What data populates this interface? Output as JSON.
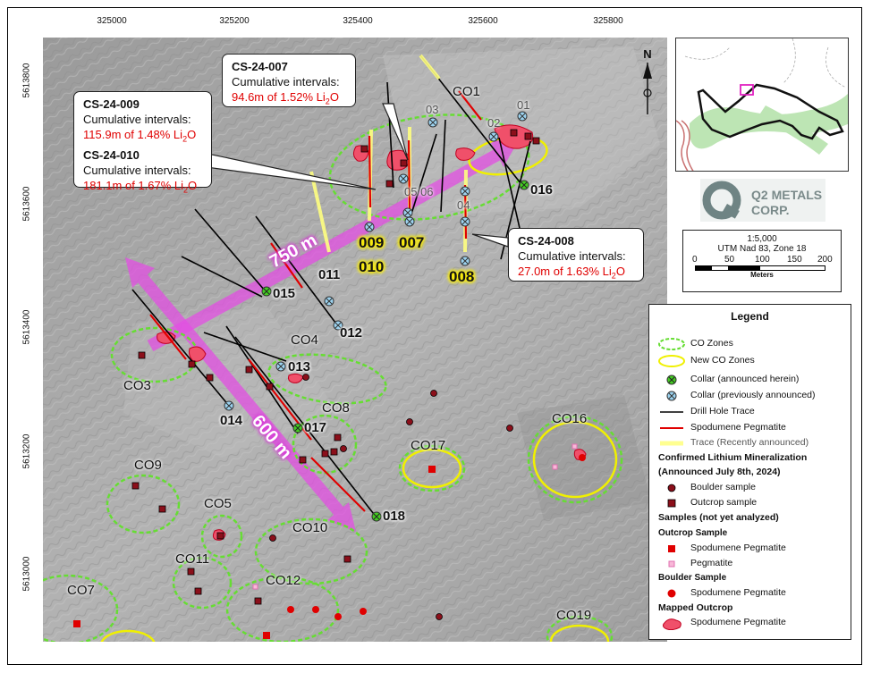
{
  "axes": {
    "x_ticks": [
      "325000",
      "325200",
      "325400",
      "325600",
      "325800"
    ],
    "y_ticks": [
      "5613800",
      "5613600",
      "5613400",
      "5613200",
      "5613000"
    ]
  },
  "callouts": {
    "cs007": {
      "id": "CS-24-007",
      "label": "Cumulative intervals:",
      "value_prefix": "94.6m of 1.52% Li",
      "sub": "2",
      "suffix": "O"
    },
    "cs009": {
      "id": "CS-24-009",
      "label": "Cumulative intervals:",
      "value_prefix": "115.9m of 1.48% Li",
      "sub": "2",
      "suffix": "O"
    },
    "cs010": {
      "id": "CS-24-010",
      "label": "Cumulative intervals:",
      "value_prefix": "181.1m of 1.67% Li",
      "sub": "2",
      "suffix": "O"
    },
    "cs008": {
      "id": "CS-24-008",
      "label": "Cumulative intervals:",
      "value_prefix": "27.0m of 1.63% Li",
      "sub": "2",
      "suffix": "O"
    }
  },
  "zones": [
    "CO1",
    "CO3",
    "CO4",
    "CO5",
    "CO7",
    "CO8",
    "CO9",
    "CO10",
    "CO11",
    "CO12",
    "CO16",
    "CO17",
    "CO19"
  ],
  "collars_new": [
    "015",
    "016",
    "017",
    "018"
  ],
  "collars_prev": [
    "011",
    "012",
    "013",
    "014"
  ],
  "collars_recent": [
    "009",
    "010",
    "007",
    "008"
  ],
  "collars_grey": [
    "01",
    "02",
    "03",
    "04",
    "05/06"
  ],
  "distances": {
    "long": "750 m",
    "short": "600 m"
  },
  "north_label": "N",
  "logo": {
    "line1": "Q2 METALS",
    "line2": "CORP."
  },
  "scale": {
    "ratio": "1:5,000",
    "projection": "UTM Nad 83, Zone 18",
    "ticks": [
      "0",
      "50",
      "100",
      "150",
      "200"
    ],
    "unit": "Meters"
  },
  "legend": {
    "title": "Legend",
    "co_zones": "CO Zones",
    "new_co_zones": "New CO Zones",
    "collar_new": "Collar (announced herein)",
    "collar_prev": "Collar (previously announced)",
    "drill_trace": "Drill Hole Trace",
    "spodumene_trace": "Spodumene Pegmatite",
    "recent_trace": "Trace (Recently announced)",
    "confirmed_head": "Confirmed Lithium Mineralization",
    "confirmed_sub": "(Announced July 8th, 2024)",
    "boulder_sample": "Boulder sample",
    "outcrop_sample": "Outcrop sample",
    "samples_head": "Samples (not yet analyzed)",
    "outcrop_head": "Outcrop Sample",
    "outcrop_spod": "Spodumene Pegmatite",
    "outcrop_peg": "Pegmatite",
    "boulder_head": "Boulder Sample",
    "boulder_spod": "Spodumene Pegmatite",
    "mapped_head": "Mapped Outcrop",
    "mapped_spod": "Spodumene Pegmatite"
  },
  "colors": {
    "accent_magenta": "#d63fd6",
    "zone_green": "#66dd33",
    "new_zone_yellow": "#f0f000",
    "red": "#e00000",
    "pink": "#f08ab5"
  }
}
